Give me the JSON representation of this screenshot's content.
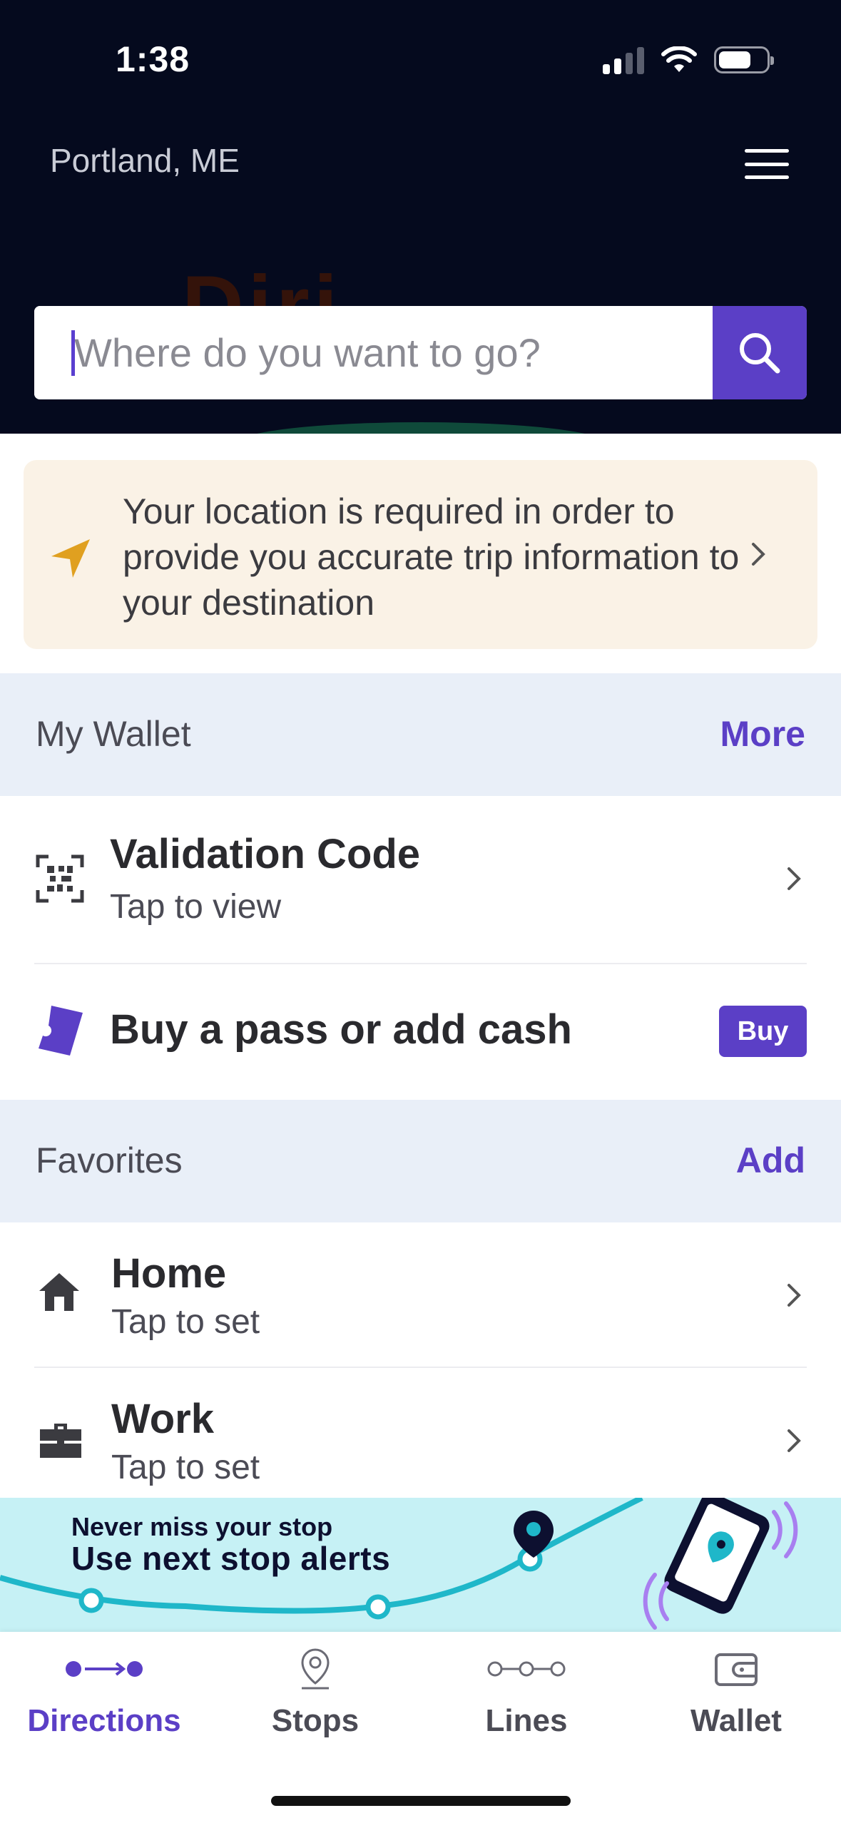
{
  "status_bar": {
    "time": "1:38"
  },
  "header": {
    "city": "Portland, ME",
    "search_placeholder": "Where do you want to go?"
  },
  "location_alert": {
    "text": "Your location is required in order to provide you accurate trip information to your destination"
  },
  "wallet": {
    "title": "My Wallet",
    "action": "More",
    "items": [
      {
        "title": "Validation Code",
        "subtitle": "Tap to view"
      },
      {
        "title": "Buy a pass or add cash",
        "button": "Buy"
      }
    ]
  },
  "favorites": {
    "title": "Favorites",
    "action": "Add",
    "items": [
      {
        "title": "Home",
        "subtitle": "Tap to set"
      },
      {
        "title": "Work",
        "subtitle": "Tap to set"
      }
    ]
  },
  "banner": {
    "small": "Never miss your stop",
    "big": "Use next stop alerts"
  },
  "tabs": [
    {
      "label": "Directions",
      "active": true
    },
    {
      "label": "Stops",
      "active": false
    },
    {
      "label": "Lines",
      "active": false
    },
    {
      "label": "Wallet",
      "active": false
    }
  ],
  "colors": {
    "header_bg": "#050a1e",
    "accent": "#5b3fc6",
    "alert_bg": "#faf2e6",
    "alert_icon": "#e0a020",
    "section_bg": "#e9eff8",
    "banner_bg": "#c6f1f5",
    "banner_teal": "#1fb7c9"
  }
}
